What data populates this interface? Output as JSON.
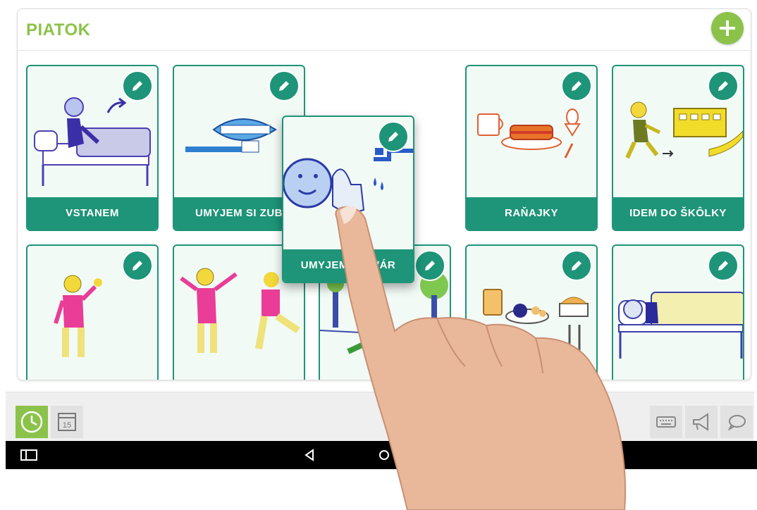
{
  "header": {
    "title": "PIATOK"
  },
  "toolbar": {
    "add_icon": "plus-icon"
  },
  "cards": [
    {
      "label": "VSTANEM",
      "picture": "get-up-pictogram",
      "edit_icon": "pencil-icon"
    },
    {
      "label": "UMYJEM SI ZUB",
      "picture": "brush-teeth-pictogram",
      "edit_icon": "pencil-icon"
    },
    {
      "label": "UMYJEM SI TVÁR",
      "picture": "wash-face-pictogram",
      "edit_icon": "pencil-icon",
      "state": "dragging"
    },
    {
      "label": "RAŇAJKY",
      "picture": "breakfast-pictogram",
      "edit_icon": "pencil-icon"
    },
    {
      "label": "IDEM DO ŠKÔLKY",
      "picture": "go-to-kindergarten-pictogram",
      "edit_icon": "pencil-icon"
    },
    {
      "label": "",
      "picture": "wave-hello-pictogram",
      "edit_icon": "pencil-icon"
    },
    {
      "label": "",
      "picture": "exercise-pictogram",
      "edit_icon": "pencil-icon"
    },
    {
      "label": "",
      "picture": "playground-pictogram",
      "edit_icon": "pencil-icon"
    },
    {
      "label": "",
      "picture": "lunch-pictogram",
      "edit_icon": "pencil-icon"
    },
    {
      "label": "",
      "picture": "nap-pictogram",
      "edit_icon": "pencil-icon"
    }
  ],
  "floating_card": {
    "label_visible": "UMYJE",
    "label_visible_end": "ÁR"
  },
  "bottom_bar": {
    "clock_icon": "clock-icon",
    "calendar_icon": "calendar-icon",
    "calendar_day": "15",
    "keyboard_icon": "keyboard-icon",
    "megaphone_icon": "megaphone-icon",
    "speech_icon": "speech-bubble-icon"
  },
  "android_nav": {
    "recents": "recents-icon",
    "back": "back-icon",
    "home": "home-icon"
  },
  "colors": {
    "accent_green": "#8bc34a",
    "card_teal": "#1e9478",
    "card_bg": "#f2faf6"
  }
}
